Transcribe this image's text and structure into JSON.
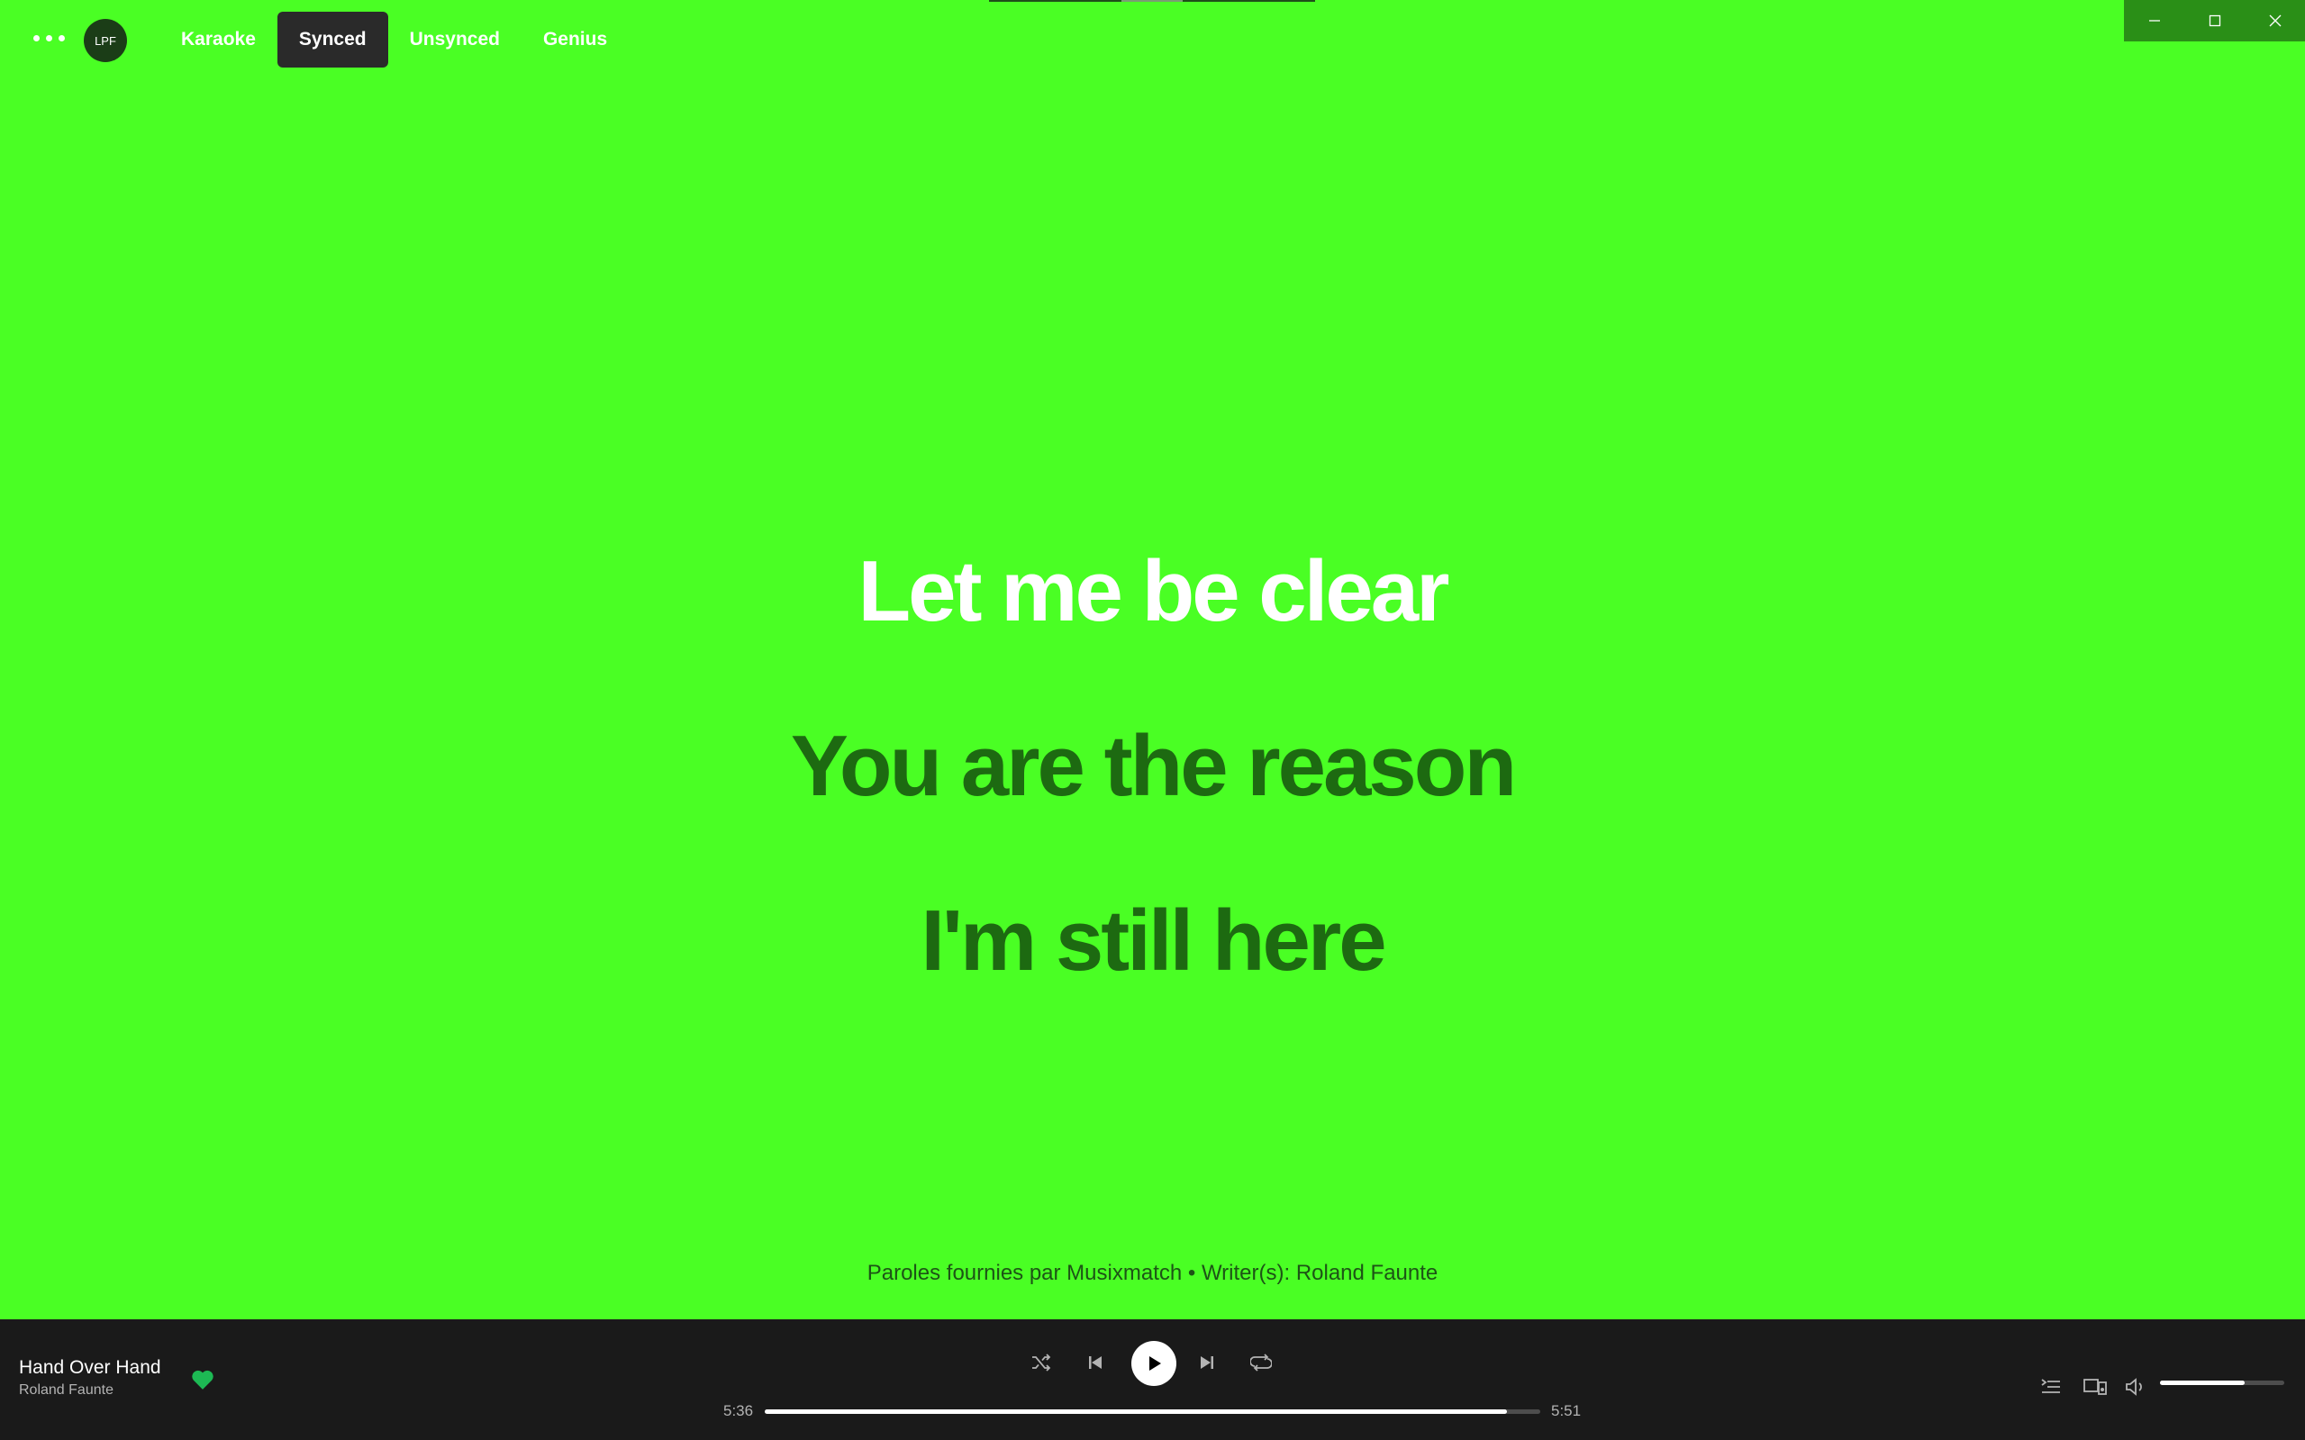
{
  "app": {
    "avatar_initials": "LPF"
  },
  "tabs": [
    {
      "label": "Karaoke",
      "active": false
    },
    {
      "label": "Synced",
      "active": true
    },
    {
      "label": "Unsynced",
      "active": false
    },
    {
      "label": "Genius",
      "active": false
    }
  ],
  "lyrics": {
    "lines": [
      "Let me be clear",
      "You are the reason",
      "I'm still here"
    ],
    "current_index": 0,
    "credits": "Paroles fournies par Musixmatch • Writer(s): Roland Faunte"
  },
  "player": {
    "title": "Hand Over Hand",
    "artist": "Roland Faunte",
    "liked": true,
    "elapsed": "5:36",
    "duration": "5:51",
    "progress_fraction": 0.957,
    "volume_fraction": 0.68
  },
  "colors": {
    "background": "#4aff24",
    "accent": "#1db954",
    "player_bg": "#1a1a1a"
  },
  "icons": [
    "more-icon",
    "minimize-icon",
    "maximize-icon",
    "close-icon",
    "heart-icon",
    "shuffle-icon",
    "previous-icon",
    "play-icon",
    "next-icon",
    "repeat-icon",
    "queue-icon",
    "device-icon",
    "volume-icon"
  ]
}
